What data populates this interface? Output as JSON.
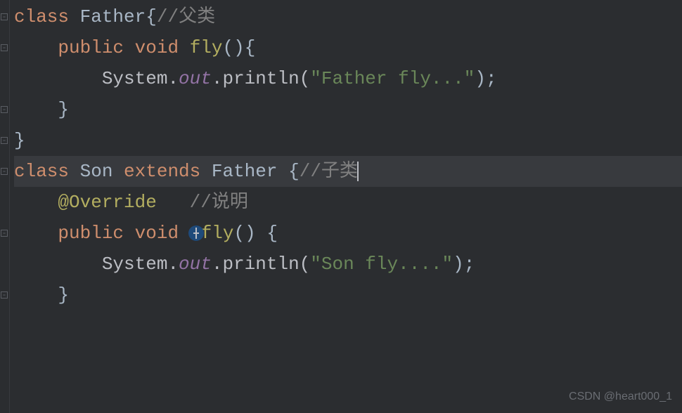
{
  "code": {
    "line1": {
      "kw1": "class",
      "type": "Father",
      "brace": "{",
      "comment": "//父类"
    },
    "line2": {
      "kw1": "public",
      "kw2": "void",
      "method": "fly",
      "parens": "(){"
    },
    "line3": {
      "prefix": "System.",
      "field": "out",
      "call": ".println(",
      "string": "\"Father fly...\"",
      "end": ");"
    },
    "line4": {
      "brace": "}"
    },
    "line5": {
      "brace": "}"
    },
    "line6": {
      "kw1": "class",
      "type1": "Son",
      "kw2": "extends",
      "type2": "Father",
      "brace": " {",
      "comment": "//子类"
    },
    "line7": {
      "annotation": "@Override",
      "comment": "//说明"
    },
    "line8": {
      "kw1": "public",
      "kw2": "void",
      "method_f": "f",
      "method_ly": "ly",
      "parens": "() {"
    },
    "line9": {
      "prefix": "System.",
      "field": "out",
      "call": ".println(",
      "string": "\"Son fly....\"",
      "end": ");"
    },
    "line10": {
      "brace": "}"
    }
  },
  "watermark": "CSDN @heart000_1"
}
